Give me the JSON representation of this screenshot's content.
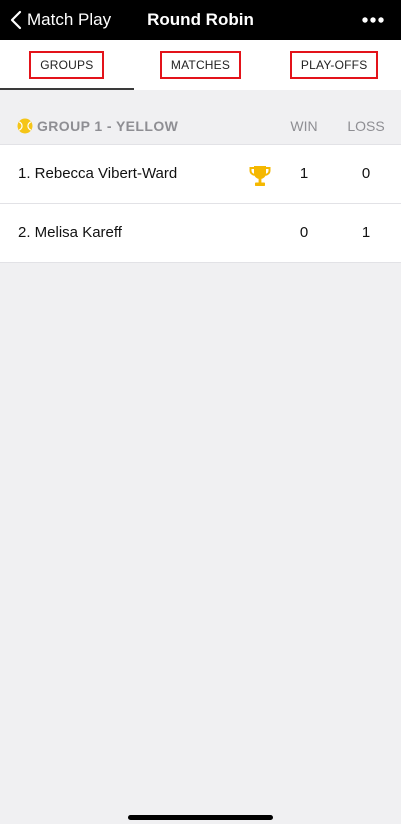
{
  "nav": {
    "back_label": "Match Play",
    "title": "Round Robin",
    "back_icon": "chevron-left-icon",
    "more_icon": "more-horizontal-icon"
  },
  "tabs": [
    {
      "label": "GROUPS",
      "active": true
    },
    {
      "label": "MATCHES",
      "active": false
    },
    {
      "label": "PLAY-OFFS",
      "active": false
    }
  ],
  "group": {
    "title": "GROUP 1 - YELLOW",
    "ball_icon": "tennis-ball-icon",
    "ball_color": "#f5c518",
    "col_win": "WIN",
    "col_loss": "LOSS",
    "rows": [
      {
        "name": "1. Rebecca Vibert-Ward",
        "win": "1",
        "loss": "0",
        "winner_icon": "trophy-icon"
      },
      {
        "name": "2. Melisa Kareff",
        "win": "0",
        "loss": "1"
      }
    ]
  },
  "colors": {
    "nav_bg": "#000000",
    "tab_highlight": "#e3131a",
    "trophy": "#f5b800",
    "background": "#f0f0f2"
  }
}
